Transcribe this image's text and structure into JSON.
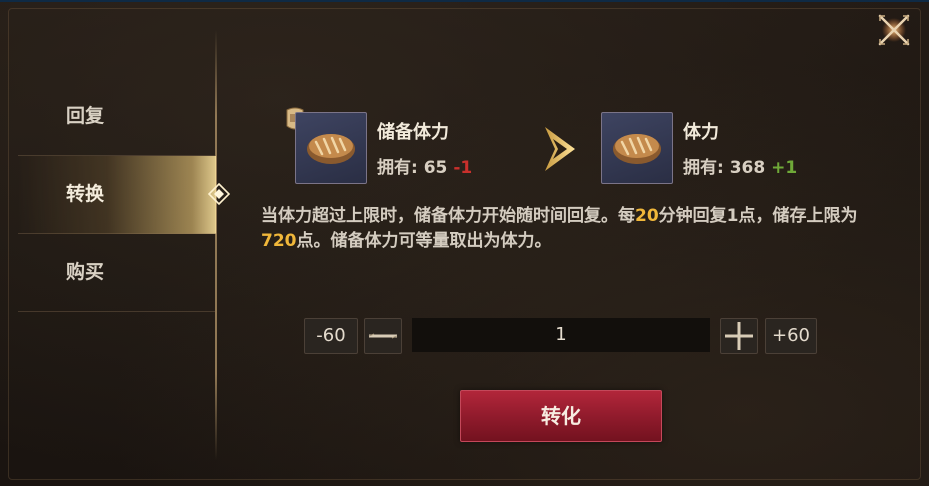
{
  "sidebar": {
    "items": [
      {
        "label": "回复",
        "active": false
      },
      {
        "label": "转换",
        "active": true
      },
      {
        "label": "购买",
        "active": false
      }
    ]
  },
  "source_item": {
    "name": "储备体力",
    "owned_prefix": "拥有: ",
    "owned_value": "65",
    "delta": "-1",
    "icon": "bread-icon"
  },
  "target_item": {
    "name": "体力",
    "owned_prefix": "拥有: ",
    "owned_value": "368",
    "delta": "+1",
    "icon": "bread-icon"
  },
  "description": {
    "part1": "当体力超过上限时，储备体力开始随时间回复。每",
    "minutes": "20",
    "part2": "分钟回复1点，储存上限为",
    "cap": "720",
    "part3": "点。储备体力可等量取出为体力。"
  },
  "quantity": {
    "minus60_label": "-60",
    "plus60_label": "+60",
    "value": "1"
  },
  "convert_button": {
    "label": "转化"
  },
  "colors": {
    "accent_gold": "#f0b73a",
    "delta_negative": "#c9302c",
    "delta_positive": "#6fa938",
    "button_red": "#a02033"
  }
}
